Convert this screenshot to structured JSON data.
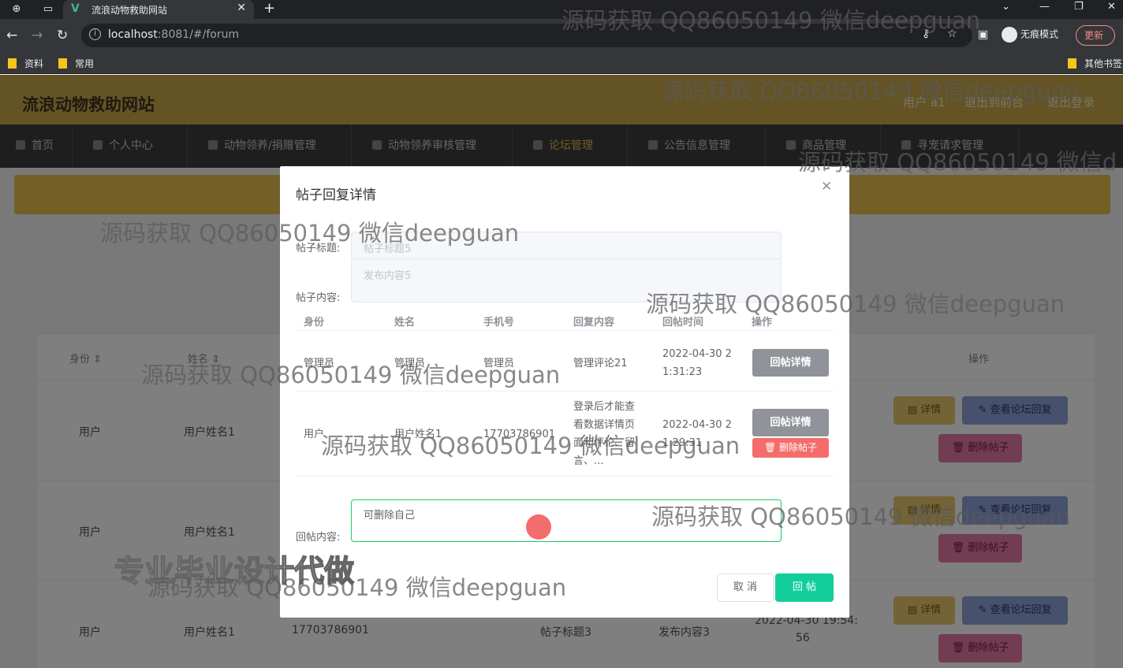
{
  "browser": {
    "tab_title": "流浪动物救助网站",
    "url_host": "localhost",
    "url_path": ":8081/#/forum",
    "incognito_label": "无痕模式",
    "update_label": "更新",
    "bookmarks": [
      "资料",
      "常用"
    ],
    "other_bookmarks": "其他书签"
  },
  "app": {
    "site_title": "流浪动物救助网站",
    "user_label": "用户 a1",
    "back_label": "退出到前台",
    "logout_label": "退出登录",
    "nav": [
      "首页",
      "个人中心",
      "动物领养/捐赠管理",
      "动物领养审核管理",
      "论坛管理",
      "公告信息管理",
      "商品管理",
      "寻宠请求管理"
    ],
    "active_nav": "论坛管理"
  },
  "table": {
    "headers": {
      "identity": "身份",
      "name": "姓名",
      "action": "操作"
    },
    "rows": [
      {
        "identity": "用户",
        "name": "用户姓名1"
      },
      {
        "identity": "用户",
        "name": "用户姓名1"
      },
      {
        "identity": "用户",
        "name": "用户姓名1",
        "phone": "17703786901",
        "title": "帖子标题3",
        "content": "发布内容3",
        "time": "2022-04-30 19:54:",
        "time2": "56"
      }
    ],
    "btn_detail": "详情",
    "btn_view": "查看论坛回复",
    "btn_delete": "删除帖子"
  },
  "dialog": {
    "title": "帖子回复详情",
    "post_title_label": "帖子标题:",
    "post_title_value": "帖子标题5",
    "post_content_label": "帖子内容:",
    "post_content_value": "发布内容5",
    "reply_headers": [
      "身份",
      "姓名",
      "手机号",
      "回复内容",
      "回帖时间",
      "操作"
    ],
    "replies": [
      {
        "identity": "管理员",
        "name": "管理员",
        "phone": "管理员",
        "content": "管理评论21",
        "time_l1": "2022-04-30 2",
        "time_l2": "1:31:23",
        "btn_detail": "回帖详情"
      },
      {
        "identity": "用户",
        "name": "用户姓名1",
        "phone": "17703786901",
        "content_l1": "登录后才能查",
        "content_l2": "看数据详情页",
        "content_l3": "面和评论、留",
        "content_l4": "言、...",
        "time_l1": "2022-04-30 2",
        "time_l2": "1:29:31",
        "btn_detail": "回帖详情",
        "btn_delete": "删除帖子"
      }
    ],
    "reply_label": "回帖内容:",
    "reply_value": "可删除自己",
    "cancel_label": "取 消",
    "submit_label": "回 帖"
  },
  "watermarks": {
    "text": "源码获取 QQ86050149 微信deepguan",
    "text_cut": "源码获取 QQ86050149 微信d",
    "big": "专业毕业设计代做"
  },
  "colors": {
    "header": "#c9a64a",
    "nav": "#3c3c3c",
    "banner": "#e8bf50",
    "submit": "#13ce9a",
    "delete": "#f56c6c"
  }
}
